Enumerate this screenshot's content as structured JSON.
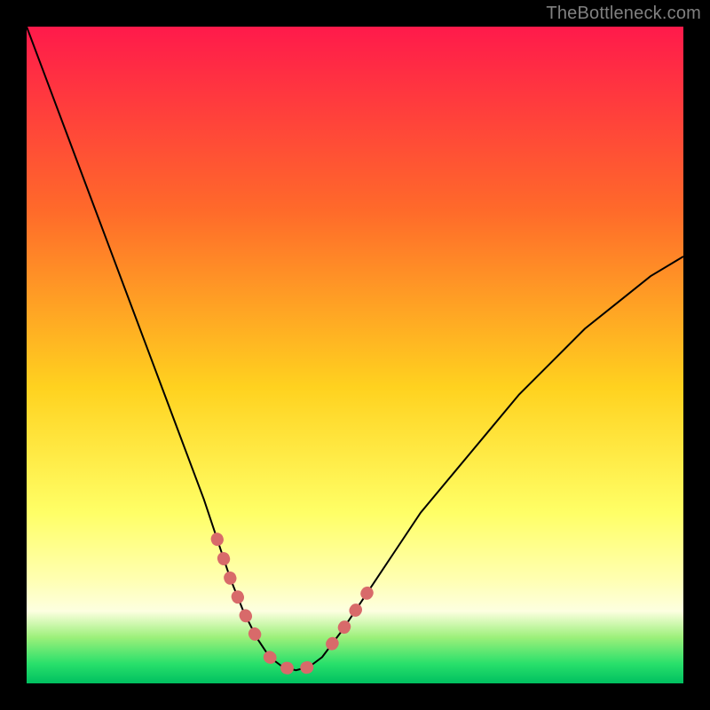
{
  "watermark": {
    "text": "TheBottleneck.com"
  },
  "gradient_colors": {
    "top": "#ff1a4b",
    "mid1": "#ff6a2a",
    "mid2": "#ffd21f",
    "mid3": "#ffff66",
    "mid4": "#ffffb0",
    "band": "#fdffe0",
    "green1": "#9cf07a",
    "green2": "#29e06b",
    "bottom": "#00c060"
  },
  "chart_data": {
    "type": "line",
    "title": "",
    "xlabel": "",
    "ylabel": "",
    "xlim": [
      0,
      100
    ],
    "ylim": [
      0,
      100
    ],
    "curve": {
      "x": [
        0.0,
        3.0,
        6.0,
        9.0,
        12.0,
        15.0,
        18.0,
        21.0,
        24.0,
        27.0,
        29.0,
        31.0,
        33.0,
        35.0,
        37.0,
        39.0,
        41.0,
        43.0,
        45.0,
        48.0,
        52.0,
        56.0,
        60.0,
        65.0,
        70.0,
        75.0,
        80.0,
        85.0,
        90.0,
        95.0,
        100.0
      ],
      "y": [
        100.0,
        92.0,
        84.0,
        76.0,
        68.0,
        60.0,
        52.0,
        44.0,
        36.0,
        28.0,
        22.0,
        16.0,
        11.0,
        7.0,
        4.0,
        2.5,
        2.0,
        2.5,
        4.0,
        8.0,
        14.0,
        20.0,
        26.0,
        32.0,
        38.0,
        44.0,
        49.0,
        54.0,
        58.0,
        62.0,
        65.0
      ]
    },
    "marker_segments": [
      {
        "x": [
          29.0,
          31.0,
          33.0,
          35.0
        ],
        "y": [
          22.0,
          16.0,
          11.0,
          7.0
        ]
      },
      {
        "x": [
          37.0,
          39.0,
          41.0,
          43.0,
          45.0
        ],
        "y": [
          4.0,
          2.5,
          2.0,
          2.5,
          4.0
        ]
      },
      {
        "x": [
          46.5,
          48.0,
          50.0,
          52.0
        ],
        "y": [
          6.0,
          8.0,
          11.0,
          14.0
        ]
      }
    ],
    "marker_color": "#d86a6a",
    "curve_color": "#000000"
  }
}
